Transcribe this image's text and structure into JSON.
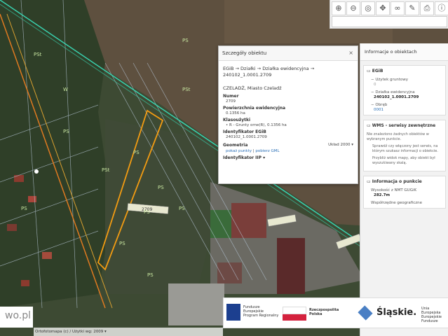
{
  "map": {
    "parcel_labels": [
      "PSt",
      "PS",
      "W",
      "PSt",
      "PS",
      "PS",
      "PS",
      "PS",
      "PS",
      "PS",
      "PS",
      "PS",
      "PSt"
    ],
    "road_label": "2709"
  },
  "toolbar": {
    "tools": [
      "zoom-in-icon",
      "zoom-out-icon",
      "locate-icon",
      "pan-icon",
      "link-icon",
      "draw-icon",
      "print-icon",
      "info-icon"
    ]
  },
  "popup": {
    "title": "Szczegóły obiektu",
    "close": "×",
    "path": "EGiB → Działki → Działka ewidencyjna → 240102_1.0001.2709",
    "location": "CZELADŹ, Miasto Czeladź",
    "fields": [
      {
        "label": "Numer",
        "value": "2709"
      },
      {
        "label": "Powierzchnia ewidencyjna",
        "value": "0.1356 ha"
      },
      {
        "label": "Klasoużytki",
        "value": "• R - Grunty orne(R), 0.1356 ha"
      },
      {
        "label": "Identyfikator EGiB",
        "value": "240102_1.0001.2709"
      }
    ],
    "geometry_label": "Geometria",
    "geometry_select": "Układ 2000 ▾",
    "link_points": "pokaż punkty",
    "link_sep": "|",
    "link_gml": "pobierz GML",
    "iip_label": "Identyfikator IIP ▾"
  },
  "sidebar": {
    "title": "Informacje o obiektach",
    "egib": {
      "title": "EGiB",
      "rows": [
        {
          "label": "Użytek gruntowy",
          "value": "0",
          "style": ""
        },
        {
          "label": "Działka ewidencyjna",
          "value": "240102_1.0001.2709",
          "style": "b"
        },
        {
          "label": "Obręb",
          "value": "0001",
          "style": "l"
        }
      ]
    },
    "wms": {
      "title": "WMS - serwisy zewnętrzne",
      "lines": [
        "Nie znaleziono żadnych obiektów w wybranym punkcie.",
        "Sprawdź czy włączony jest serwis, na którym szukasz informacji o obiekcie.",
        "Przybliż widok mapy, aby obiekt był wyszukiwany skalą."
      ]
    },
    "point": {
      "title": "Informacja o punkcie",
      "height_label": "Wysokość z NMT GUGiK",
      "height_value": "282.7m",
      "coords_label": "Współrzędne geograficzne"
    }
  },
  "banner": {
    "fe_line1": "Fundusze",
    "fe_line2": "Europejskie",
    "fe_line3": "Program Regionalny",
    "rp_line1": "Rzeczpospolita",
    "rp_line2": "Polska",
    "slaskie": "Śląskie.",
    "eu_line1": "Unia Europejska",
    "eu_line2": "Europejskie Fundusze"
  },
  "corner_text": "wo.pl",
  "footer_text": "Ortofotomapa (c) / Użytki wg: 2009 ▾",
  "colors": {
    "parcel_highlight": "#f39c12",
    "road_line": "#39d3b0",
    "parcel_lines": "#b8c8d8",
    "fields": "#5b4d3d"
  }
}
